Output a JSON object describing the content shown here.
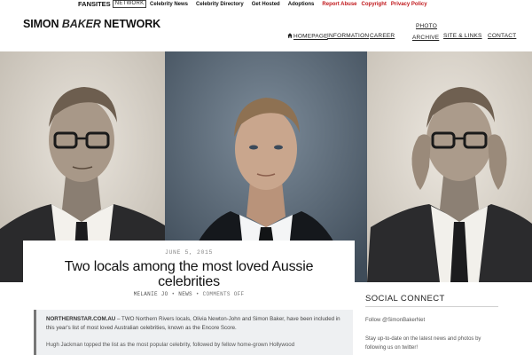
{
  "topbar": {
    "fansites_word": "FANSITES",
    "network_word": "NETWORK",
    "links": [
      {
        "label": "Celebrity News",
        "color": "#111111"
      },
      {
        "label": "Celebrity Directory",
        "color": "#111111"
      },
      {
        "label": "Get Hosted",
        "color": "#111111"
      },
      {
        "label": "Adoptions",
        "color": "#111111"
      },
      {
        "label": "Report Abuse",
        "color": "#c0161a"
      },
      {
        "label": "Copyright",
        "color": "#c0161a"
      },
      {
        "label": "Privacy Policy",
        "color": "#c0161a"
      }
    ]
  },
  "header": {
    "logo_part1": "SIMON ",
    "logo_part2": "BAKER",
    "logo_part3": " NETWORK",
    "nav": {
      "homepage": "HOMEPAGE",
      "information": "INFORMATION",
      "career": "CAREER",
      "photo_line1": "PHOTO",
      "photo_line2": "ARCHIVE",
      "site_links": "SITE & LINKS",
      "contact": "CONTACT"
    }
  },
  "hero": {
    "panels": [
      "left-portrait-glasses",
      "center-portrait-suit",
      "right-portrait-adjusting-glasses"
    ]
  },
  "article": {
    "date": "JUNE 5, 2015",
    "title": "Two locals among the most loved Aussie celebrities",
    "author": "MELANIE JO",
    "separator": "•",
    "category": "NEWS",
    "comments": "COMMENTS OFF",
    "excerpt_source": "NORTHERNSTAR.COM.AU",
    "excerpt_text": " – TWO Northern Rivers locals, Olivia Newton-John and Simon Baker, have been included in this year's list of most loved Australian celebrities, known as the Encore Score.",
    "excerpt_p2": "Hugh Jackman topped the list as the most popular celebrity, followed by fellow home-grown Hollywood"
  },
  "sidebar": {
    "title": "SOCIAL CONNECT",
    "follow": "Follow @SimonBakerNet",
    "text": "Stay up-to-date on the latest news and photos by following us on twitter!"
  },
  "colors": {
    "accent_red": "#c0161a",
    "hero_center_bg": "#4a5a6a",
    "excerpt_bg": "#eef0f2"
  }
}
